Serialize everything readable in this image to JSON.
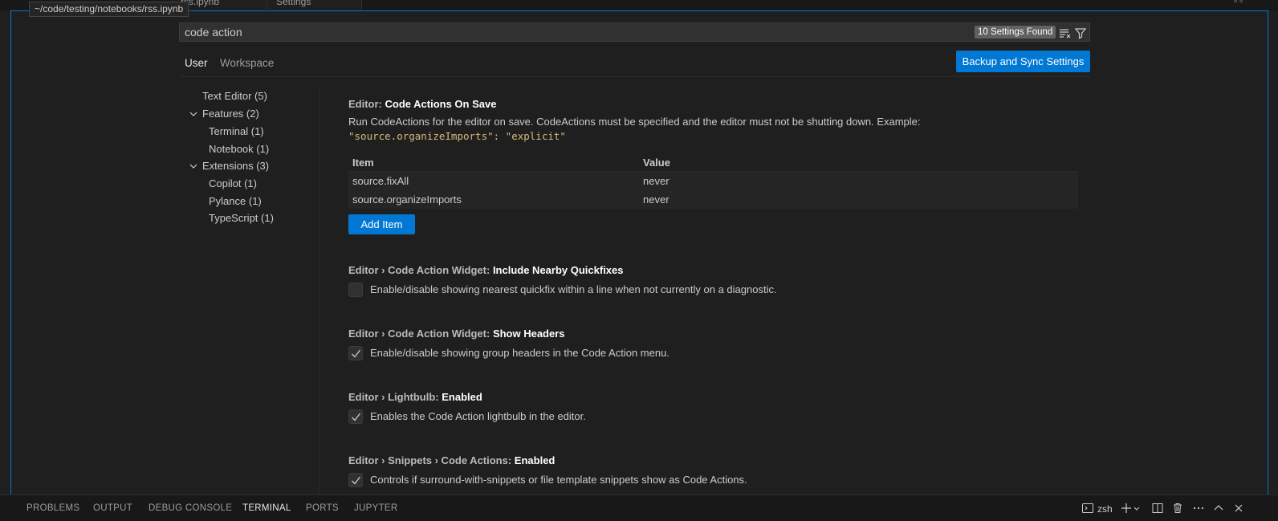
{
  "tooltip": "~/code/testing/notebooks/rss.ipynb",
  "top_tabs": [
    "rss.ipynb",
    "Settings"
  ],
  "search": {
    "value": "code action",
    "results_count": "10 Settings Found"
  },
  "scope_tabs": {
    "user": "User",
    "workspace": "Workspace"
  },
  "sync_button": "Backup and Sync Settings",
  "toc": {
    "text_editor": "Text Editor (5)",
    "features": "Features (2)",
    "terminal": "Terminal (1)",
    "notebook": "Notebook (1)",
    "extensions": "Extensions (3)",
    "copilot": "Copilot (1)",
    "pylance": "Pylance (1)",
    "typescript": "TypeScript (1)"
  },
  "settings": {
    "code_actions_on_save": {
      "category": "Editor: ",
      "name": "Code Actions On Save",
      "description": "Run CodeActions for the editor on save. CodeActions must be specified and the editor must not be shutting down. Example:",
      "example": "\"source.organizeImports\": \"explicit\"",
      "table": {
        "head_item": "Item",
        "head_value": "Value",
        "rows": [
          {
            "item": "source.fixAll",
            "value": "never"
          },
          {
            "item": "source.organizeImports",
            "value": "never"
          }
        ]
      },
      "add_item": "Add Item"
    },
    "nearby_quickfixes": {
      "category": "Editor › Code Action Widget: ",
      "name": "Include Nearby Quickfixes",
      "description": "Enable/disable showing nearest quickfix within a line when not currently on a diagnostic.",
      "checked": false
    },
    "show_headers": {
      "category": "Editor › Code Action Widget: ",
      "name": "Show Headers",
      "description": "Enable/disable showing group headers in the Code Action menu.",
      "checked": true
    },
    "lightbulb": {
      "category": "Editor › Lightbulb: ",
      "name": "Enabled",
      "description": "Enables the Code Action lightbulb in the editor.",
      "checked": true
    },
    "snippets": {
      "category": "Editor › Snippets › Code Actions: ",
      "name": "Enabled",
      "description": "Controls if surround-with-snippets or file template snippets show as Code Actions.",
      "checked": true
    }
  },
  "panel": {
    "tabs": [
      "PROBLEMS",
      "OUTPUT",
      "DEBUG CONSOLE",
      "TERMINAL",
      "PORTS",
      "JUPYTER"
    ],
    "active": "TERMINAL",
    "shell": "zsh"
  },
  "colors": {
    "accent": "#0078d4",
    "background": "#1f1f1f",
    "code": "#d7ba7d"
  }
}
